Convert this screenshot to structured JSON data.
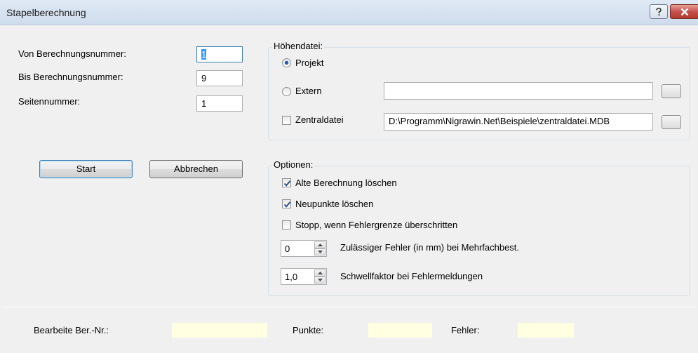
{
  "window": {
    "title": "Stapelberechnung",
    "help_icon": "question-mark-icon",
    "close_icon": "close-icon"
  },
  "range": {
    "from_label": "Von Berechnungsnummer:",
    "from_value": "1",
    "to_label": "Bis Berechnungsnummer:",
    "to_value": "9",
    "page_label": "Seitennummer:",
    "page_value": "1"
  },
  "buttons": {
    "start": "Start",
    "cancel": "Abbrechen"
  },
  "hoehendatei": {
    "caption": "Höhendatei:",
    "projekt_label": "Projekt",
    "projekt_selected": true,
    "extern_label": "Extern",
    "extern_path": "",
    "zentral_label": "Zentraldatei",
    "zentral_checked": false,
    "zentral_path": "D:\\Programm\\Nigrawin.Net\\Beispiele\\zentraldatei.MDB"
  },
  "optionen": {
    "caption": "Optionen:",
    "alte_label": "Alte Berechnung löschen",
    "alte_checked": true,
    "neu_label": "Neupunkte löschen",
    "neu_checked": true,
    "stopp_label": "Stopp, wenn Fehlergrenze überschritten",
    "stopp_checked": false,
    "fehler_value": "0",
    "fehler_label": "Zulässiger Fehler (in mm) bei Mehrfachbest.",
    "schwell_value": "1,0",
    "schwell_label": "Schwellfaktor bei Fehlermeldungen"
  },
  "status": {
    "bearbeite_label": "Bearbeite Ber.-Nr.:",
    "bearbeite_value": "",
    "punkte_label": "Punkte:",
    "punkte_value": "",
    "fehler_label": "Fehler:",
    "fehler_value": ""
  },
  "colors": {
    "accent": "#3399ff",
    "status_bg": "#ffffe1"
  }
}
